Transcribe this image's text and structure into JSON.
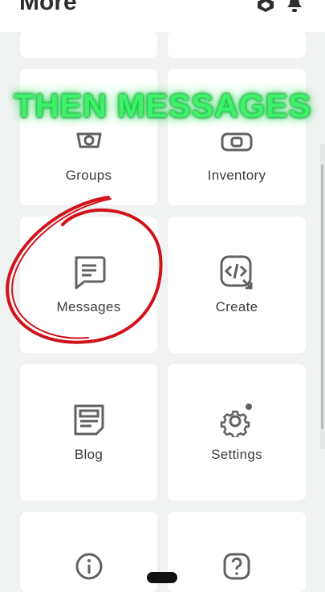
{
  "header": {
    "title": "More"
  },
  "overlay": {
    "banner_text": "THEN MESSAGES"
  },
  "tiles": [
    {
      "label": "Groups",
      "icon": "groups-icon"
    },
    {
      "label": "Inventory",
      "icon": "inventory-icon"
    },
    {
      "label": "Messages",
      "icon": "messages-icon"
    },
    {
      "label": "Create",
      "icon": "create-icon"
    },
    {
      "label": "Blog",
      "icon": "blog-icon"
    },
    {
      "label": "Settings",
      "icon": "settings-icon"
    },
    {
      "label": "",
      "icon": "info-icon"
    },
    {
      "label": "",
      "icon": "help-icon"
    }
  ],
  "colors": {
    "banner": "#3ff06a",
    "annotation_circle": "#d0121b",
    "tile_bg": "#ffffff",
    "page_bg": "#f1f3f3"
  }
}
